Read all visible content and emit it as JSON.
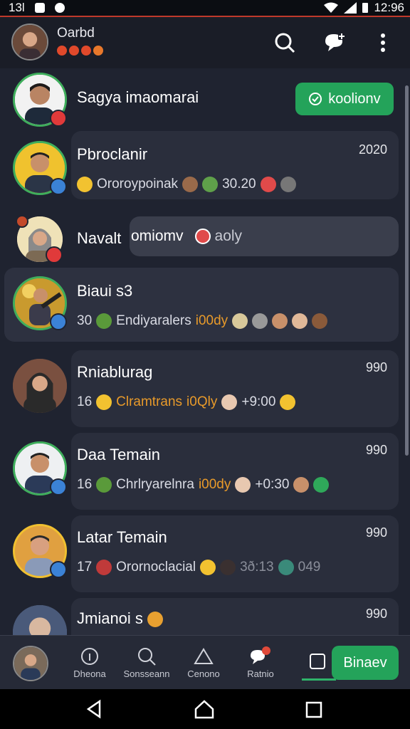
{
  "status": {
    "left": "13l",
    "time": "12:96"
  },
  "header": {
    "title": "Oarbd",
    "search_icon": "search-icon",
    "compose_icon": "chat-add-icon",
    "menu_icon": "more-vertical-icon"
  },
  "pinned": {
    "name": "Sagya imaomarai",
    "button_label": "koolionv"
  },
  "chats": [
    {
      "name": "Pbroclanir",
      "time": "2020",
      "sub_a": "Ororoypoinak",
      "sub_b": "30.20"
    },
    {
      "name": "Navalt",
      "bubble_a": "omiomv",
      "bubble_b": "aoly"
    },
    {
      "name": "Biaui s3",
      "count": "30",
      "sub_a": "Endiyaralers",
      "sub_b": "i00dy"
    },
    {
      "name": "Rniablurag",
      "time": "990",
      "count": "16",
      "sub_a": "Clramtrans",
      "sub_b": "i0Qly",
      "sub_c": "+9:00"
    },
    {
      "name": "Daa Temain",
      "time": "990",
      "count": "16",
      "sub_a": "Chrlryarelnra",
      "sub_b": "i00dy",
      "sub_c": "+0:30"
    },
    {
      "name": "Latar Temain",
      "time": "990",
      "count": "17",
      "sub_a": "Orornoclacial",
      "sub_b": "3ð:13",
      "sub_c": "049"
    },
    {
      "name": "Jmianoi s",
      "time": "990"
    }
  ],
  "bottom_nav": [
    {
      "label": "Dheona"
    },
    {
      "label": "Sonsseann"
    },
    {
      "label": "Cenono"
    },
    {
      "label": "Ratnio"
    }
  ],
  "bottom_action": {
    "label": "Binaev"
  },
  "colors": {
    "accent_green": "#24a35a",
    "background": "#1f2330"
  }
}
